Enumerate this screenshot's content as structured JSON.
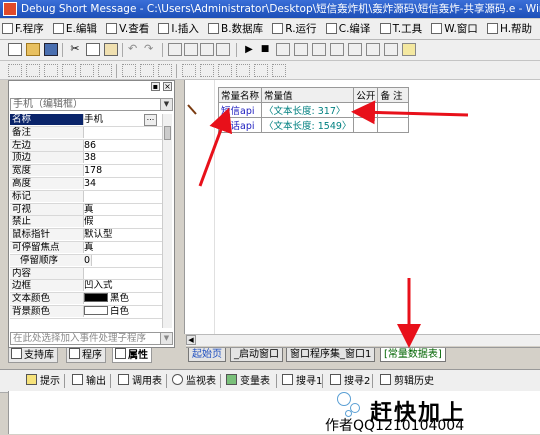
{
  "window": {
    "title": "Debug Short Message - C:\\Users\\Administrator\\Desktop\\短信轰炸机\\轰炸源码\\短信轰炸-共享源码.e - Windows窗口"
  },
  "menu": [
    {
      "label": "F.程序"
    },
    {
      "label": "E.编辑"
    },
    {
      "label": "V.查看"
    },
    {
      "label": "I.插入"
    },
    {
      "label": "B.数据库"
    },
    {
      "label": "R.运行"
    },
    {
      "label": "C.编译"
    },
    {
      "label": "T.工具"
    },
    {
      "label": "W.窗口"
    },
    {
      "label": "H.帮助"
    }
  ],
  "left_panel": {
    "component_selector": "手机（编辑框）",
    "properties": [
      {
        "name": "名称",
        "value": "手机",
        "selected": true
      },
      {
        "name": "备注",
        "value": ""
      },
      {
        "name": "左边",
        "value": "86"
      },
      {
        "name": "顶边",
        "value": "38"
      },
      {
        "name": "宽度",
        "value": "178"
      },
      {
        "name": "高度",
        "value": "34"
      },
      {
        "name": "标记",
        "value": ""
      },
      {
        "name": "可视",
        "value": "真"
      },
      {
        "name": "禁止",
        "value": "假"
      },
      {
        "name": "鼠标指针",
        "value": "默认型"
      },
      {
        "name": "可停留焦点",
        "value": "真"
      },
      {
        "name": "停留顺序",
        "value": "0",
        "sub": true
      },
      {
        "name": "内容",
        "value": ""
      },
      {
        "name": "边框",
        "value": "凹入式"
      },
      {
        "name": "文本颜色",
        "value": "黑色",
        "swatch": "#000000"
      },
      {
        "name": "背景颜色",
        "value": "白色",
        "swatch": "#ffffff"
      }
    ],
    "event_placeholder": "在此处选择加入事件处理子程序",
    "tabs": [
      {
        "label": "支持库"
      },
      {
        "label": "程序"
      },
      {
        "label": "属性"
      }
    ]
  },
  "data_table": {
    "headers": [
      "常量名称",
      "常量值",
      "公开",
      "备 注"
    ],
    "rows": [
      {
        "name": "短信api",
        "value": "〈文本长度: 317〉"
      },
      {
        "name": "电话api",
        "value": "〈文本长度: 1549〉"
      }
    ]
  },
  "editor_tabs": [
    {
      "label": "起始页"
    },
    {
      "label": "_启动窗口"
    },
    {
      "label": "窗口程序集_窗口1"
    },
    {
      "label": "[常量数据表]"
    }
  ],
  "bottom_tabs": [
    {
      "label": "提示",
      "icon": "lightbulb-icon"
    },
    {
      "label": "输出",
      "icon": "output-icon"
    },
    {
      "label": "调用表",
      "icon": "call-stack-icon"
    },
    {
      "label": "监视表",
      "icon": "magnifier-icon"
    },
    {
      "label": "变量表",
      "icon": "variables-icon"
    },
    {
      "label": "搜寻1",
      "icon": "search-icon"
    },
    {
      "label": "搜寻2",
      "icon": "search-icon"
    },
    {
      "label": "剪辑历史",
      "icon": "clipboard-icon"
    }
  ],
  "watermark": {
    "title": "赶快加上",
    "author": "作者QQ1210104004"
  },
  "colors": {
    "annotation_arrow": "#e8101a",
    "title_bar": "#1d4fb8"
  }
}
